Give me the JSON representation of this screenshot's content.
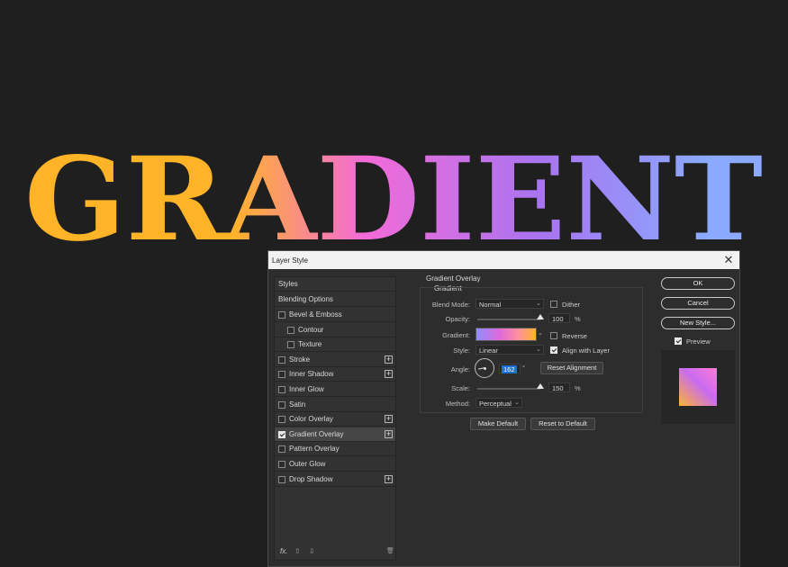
{
  "hero": {
    "text": "GRADIENT",
    "colors": {
      "stop1": "#ffb428",
      "stop2": "#f36bd7",
      "stop3": "#a874f0",
      "stop4": "#8aa9ff"
    }
  },
  "dialog": {
    "title": "Layer Style",
    "close_glyph": "✕",
    "styles_panel": {
      "header": "Styles",
      "blending": "Blending Options",
      "items": [
        {
          "label": "Bevel & Emboss",
          "checked": false,
          "plus": false
        },
        {
          "label": "Contour",
          "checked": false,
          "plus": false
        },
        {
          "label": "Texture",
          "checked": false,
          "plus": false
        },
        {
          "label": "Stroke",
          "checked": false,
          "plus": true
        },
        {
          "label": "Inner Shadow",
          "checked": false,
          "plus": true
        },
        {
          "label": "Inner Glow",
          "checked": false,
          "plus": false
        },
        {
          "label": "Satin",
          "checked": false,
          "plus": false
        },
        {
          "label": "Color Overlay",
          "checked": false,
          "plus": true
        },
        {
          "label": "Gradient Overlay",
          "checked": true,
          "plus": true
        },
        {
          "label": "Pattern Overlay",
          "checked": false,
          "plus": false
        },
        {
          "label": "Outer Glow",
          "checked": false,
          "plus": false
        },
        {
          "label": "Drop Shadow",
          "checked": false,
          "plus": true
        }
      ],
      "plus_glyph": "+",
      "bottom": {
        "fx": "fx.",
        "up": "⇧",
        "down": "⇩",
        "trash": "🗑"
      }
    },
    "gradient_overlay": {
      "section_title": "Gradient Overlay",
      "group_title": "Gradient",
      "blend_mode_label": "Blend Mode:",
      "blend_mode_value": "Normal",
      "dither_label": "Dither",
      "opacity_label": "Opacity:",
      "opacity_value": "100",
      "opacity_unit": "%",
      "opacity_level": 1.0,
      "gradient_label": "Gradient:",
      "reverse_label": "Reverse",
      "style_label": "Style:",
      "style_value": "Linear",
      "align_label": "Align with Layer",
      "angle_label": "Angle:",
      "angle_value": "162",
      "angle_unit": "°",
      "reset_alignment": "Reset Alignment",
      "scale_label": "Scale:",
      "scale_value": "150",
      "scale_unit": "%",
      "scale_level": 1.0,
      "method_label": "Method:",
      "method_value": "Perceptual",
      "make_default": "Make Default",
      "reset_default": "Reset to Default",
      "dropdown_glyph": "⌄"
    },
    "right": {
      "ok": "OK",
      "cancel": "Cancel",
      "new_style": "New Style...",
      "preview_label": "Preview"
    }
  }
}
